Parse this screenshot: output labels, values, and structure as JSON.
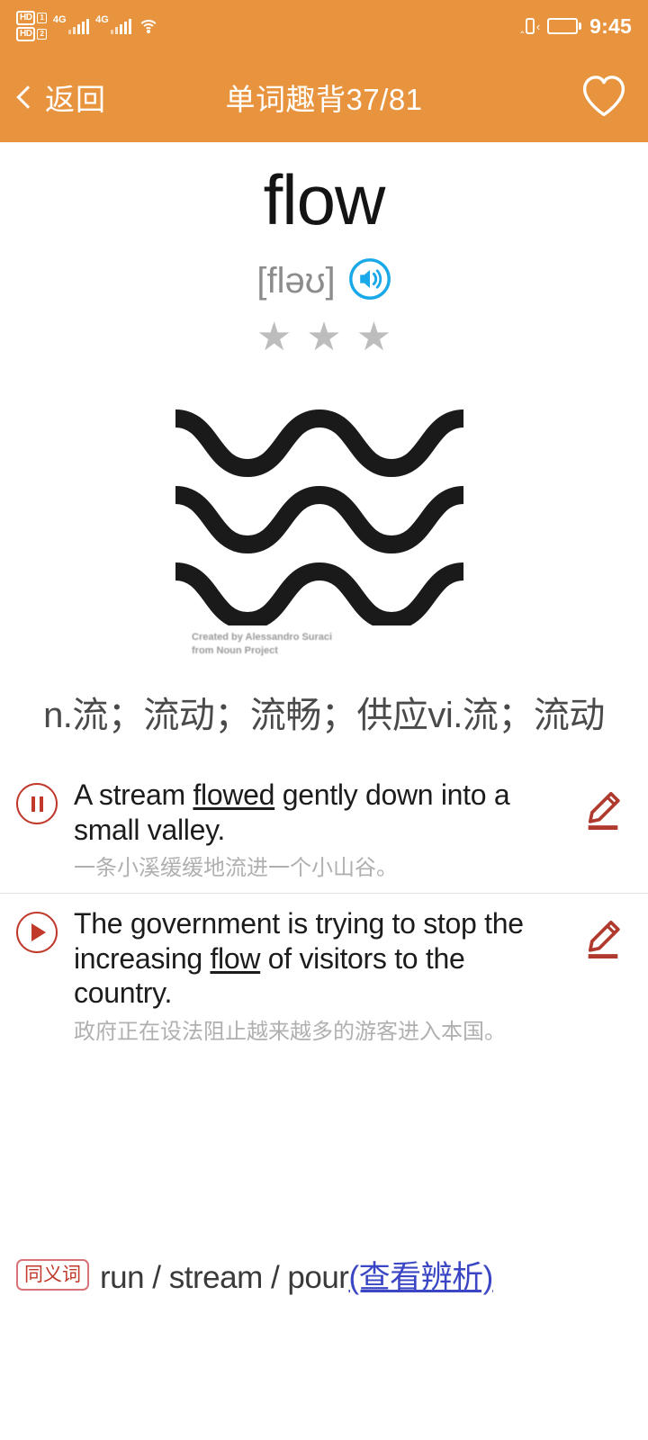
{
  "status_bar": {
    "hd_labels": [
      "HD",
      "HD"
    ],
    "sim_numbers": [
      "1",
      "2"
    ],
    "network_labels": [
      "4G",
      "4G"
    ],
    "wifi_icon": "wifi-icon",
    "vibrate_icon": "vibrate-icon",
    "battery_icon": "battery-icon",
    "time": "9:45"
  },
  "app_bar": {
    "back_label": "返回",
    "back_icon": "chevron-left-icon",
    "title": "单词趣背37/81",
    "favorite_icon": "heart-outline-icon",
    "background_color": "#e8943f"
  },
  "word_card": {
    "word": "flow",
    "phonetic": "[fləʊ]",
    "speaker_icon": "speaker-icon",
    "speaker_color": "#1aa9e8",
    "star_glyph": "★",
    "star_count": 3,
    "star_color": "#bdbdbd",
    "illustration_name": "three-wavy-lines-icon",
    "attribution_line1": "Created by Alessandro Suraci",
    "attribution_line2": "from Noun Project",
    "definition": "n.流；流动；流畅；供应vi.流；流动"
  },
  "sentences": [
    {
      "audio_icon": "pause-icon",
      "audio_state": "playing",
      "en_before": "A stream ",
      "en_highlight": "flowed",
      "en_after": " gently down into a small valley.",
      "cn": "一条小溪缓缓地流进一个小山谷。",
      "edit_icon": "pencil-edit-icon"
    },
    {
      "audio_icon": "play-icon",
      "audio_state": "paused",
      "en_before": "The government is trying to stop the increasing ",
      "en_highlight": "flow",
      "en_after": " of visitors to the country.",
      "cn": "政府正在设法阻止越来越多的游客进入本国。",
      "edit_icon": "pencil-edit-icon"
    }
  ],
  "synonyms": {
    "badge_label": "同义词",
    "list": "run / stream / pour",
    "link_label": "(查看辨析)",
    "link_color": "#3b46c4",
    "badge_color": "#c0392b"
  }
}
